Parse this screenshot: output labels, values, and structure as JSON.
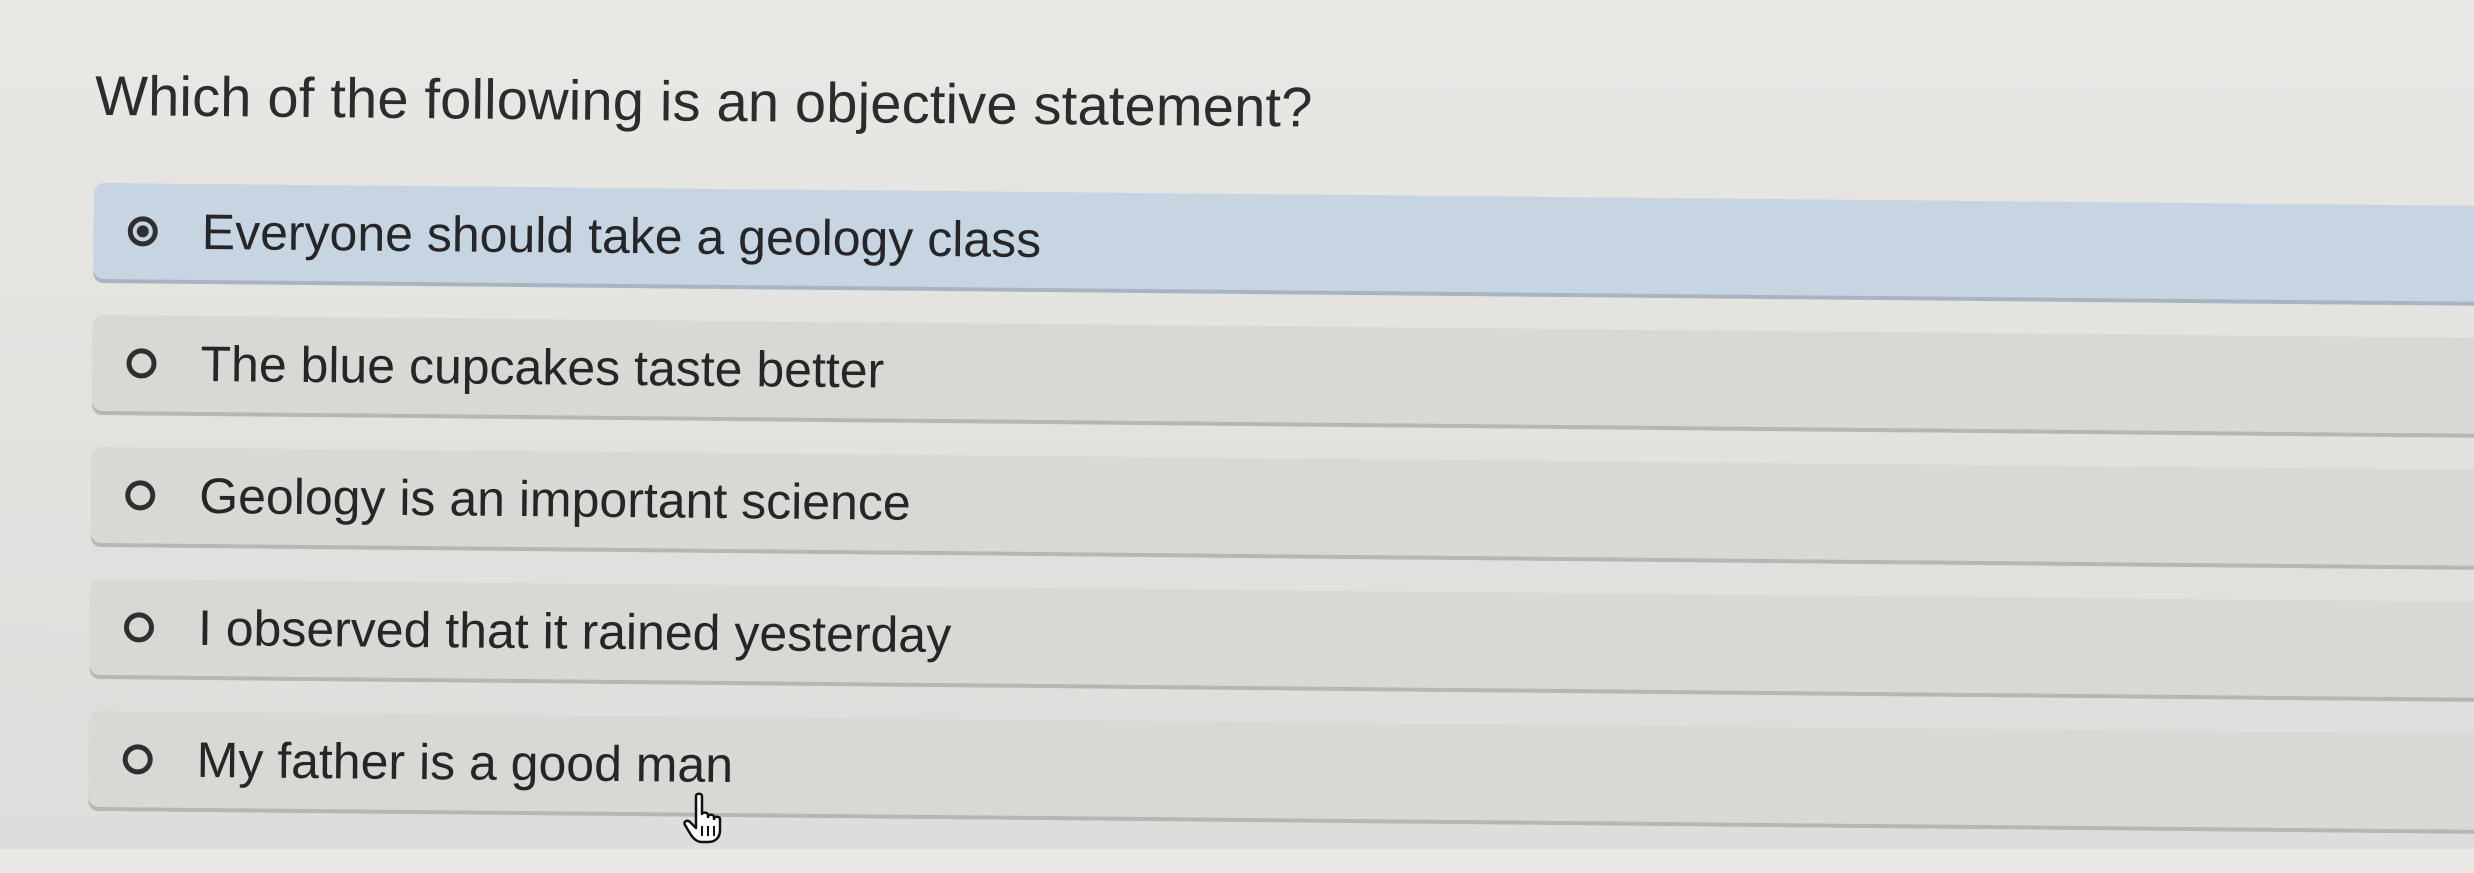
{
  "quiz": {
    "question": "Which of the following is an objective statement?",
    "options": [
      {
        "label": "Everyone should take a geology class",
        "selected": true
      },
      {
        "label": "The blue cupcakes taste better",
        "selected": false
      },
      {
        "label": "Geology is an important science",
        "selected": false
      },
      {
        "label": "I observed that it rained yesterday",
        "selected": false
      },
      {
        "label": "My father is a good man",
        "selected": false
      }
    ]
  },
  "cursor": {
    "icon": "hand-pointer-icon"
  },
  "colors": {
    "selected_option_background": "#c7d5e2",
    "option_background": "#d9d8d5",
    "text": "#262628"
  }
}
